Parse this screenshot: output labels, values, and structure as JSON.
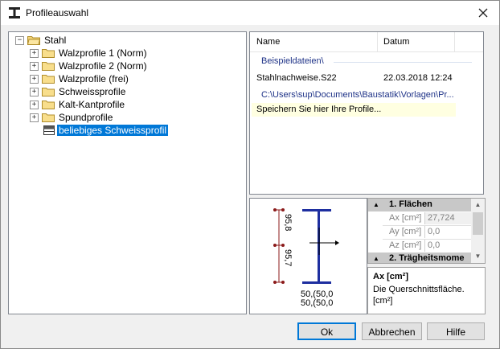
{
  "window": {
    "title": "Profileauswahl",
    "icon": "i-beam-profile-icon"
  },
  "tree": {
    "root": {
      "label": "Stahl",
      "expander": "−"
    },
    "items": [
      {
        "label": "Walzprofile 1 (Norm)",
        "expander": "+"
      },
      {
        "label": "Walzprofile 2 (Norm)",
        "expander": "+"
      },
      {
        "label": "Walzprofile (frei)",
        "expander": "+"
      },
      {
        "label": "Schweissprofile",
        "expander": "+"
      },
      {
        "label": "Kalt-Kantprofile",
        "expander": "+"
      },
      {
        "label": "Spundprofile",
        "expander": "+"
      }
    ],
    "selected": {
      "label": "beliebiges Schweissprofil"
    }
  },
  "files": {
    "col_name": "Name",
    "col_date": "Datum",
    "group1": "Beispieldateien\\",
    "row1": {
      "name": "Stahlnachweise.S22",
      "date": "22.03.2018 12:24"
    },
    "group2": "C:\\Users\\sup\\Documents\\Baustatik\\Vorlagen\\Pr...",
    "hint": "Speichern Sie hier Ihre Profile..."
  },
  "preview": {
    "dim_left_1": "95,8",
    "dim_left_2": "95,7",
    "dim_bottom_1": "50,(50,0",
    "dim_bottom_2": "50,(50,0"
  },
  "props": {
    "cat1": "1. Flächen",
    "cat2": "2. Trägheitsmome",
    "rows": [
      {
        "name": "Ax [cm²]",
        "value": "27,724"
      },
      {
        "name": "Ay [cm²]",
        "value": "0,0"
      },
      {
        "name": "Az [cm²]",
        "value": "0,0"
      }
    ]
  },
  "description": {
    "title": "Ax [cm²]",
    "text": "Die Querschnittsfläche. [cm²]"
  },
  "buttons": {
    "ok": "Ok",
    "cancel": "Abbrechen",
    "help": "Hilfe"
  }
}
